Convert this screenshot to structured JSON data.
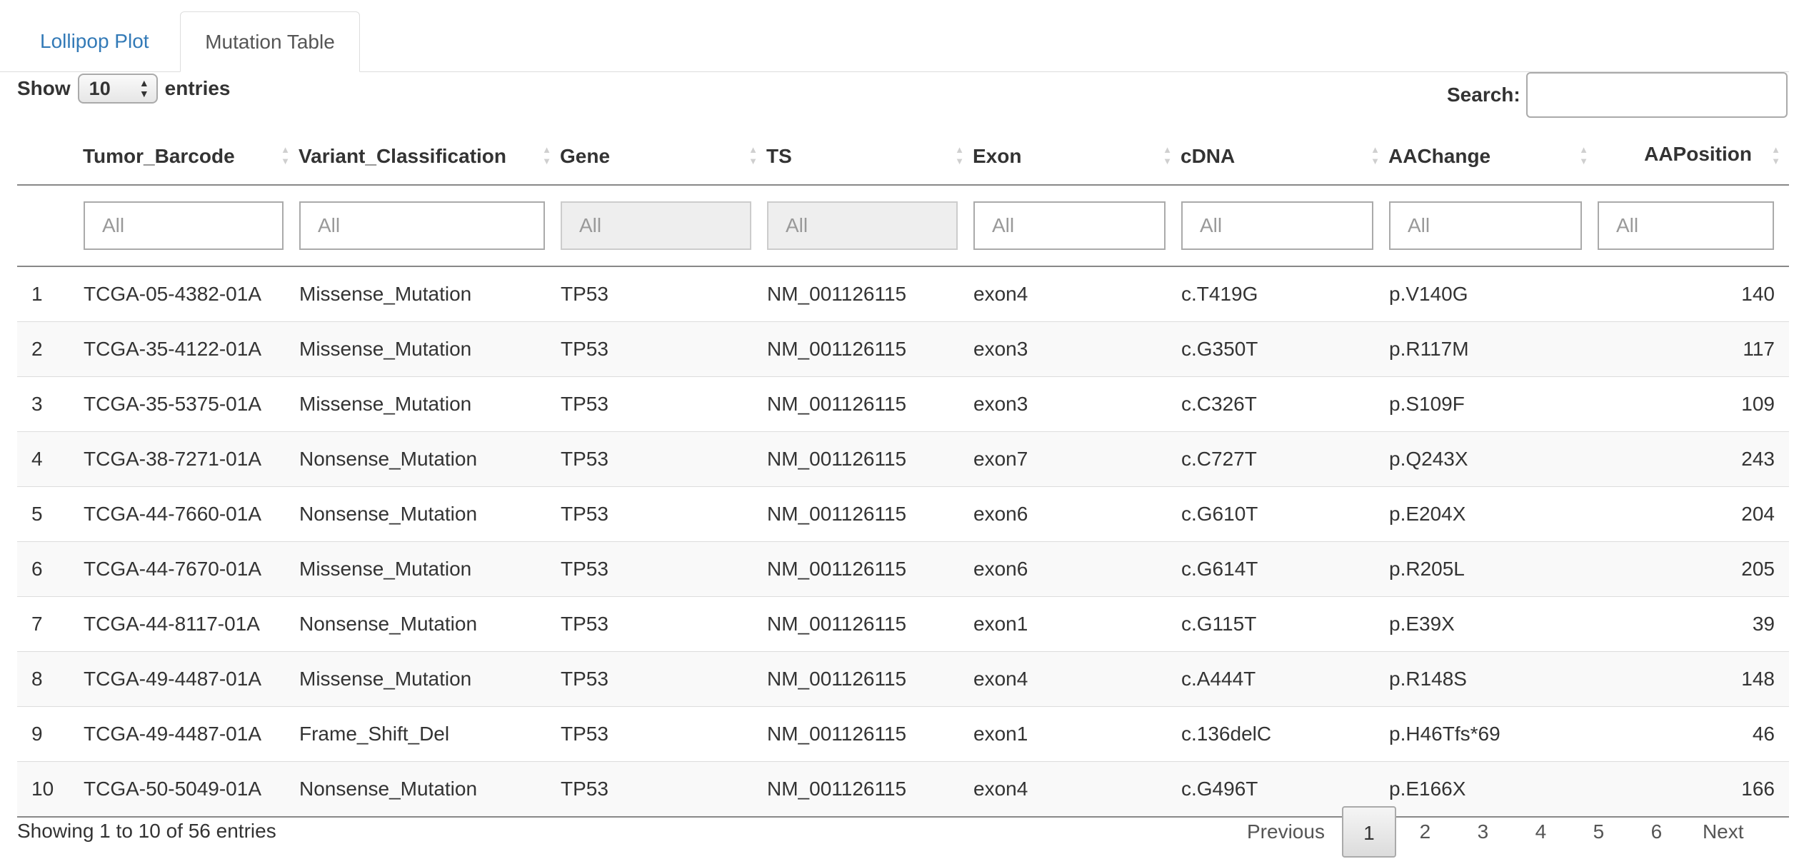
{
  "tabs": [
    {
      "label": "Lollipop Plot",
      "active": false
    },
    {
      "label": "Mutation Table",
      "active": true
    }
  ],
  "length": {
    "show": "Show",
    "value": "10",
    "entries": "entries"
  },
  "search": {
    "label": "Search:",
    "value": ""
  },
  "table": {
    "columns": [
      "",
      "Tumor_Barcode",
      "Variant_Classification",
      "Gene",
      "TS",
      "Exon",
      "cDNA",
      "AAChange",
      "AAPosition"
    ],
    "filter_placeholder": "All",
    "rows": [
      [
        "1",
        "TCGA-05-4382-01A",
        "Missense_Mutation",
        "TP53",
        "NM_001126115",
        "exon4",
        "c.T419G",
        "p.V140G",
        "140"
      ],
      [
        "2",
        "TCGA-35-4122-01A",
        "Missense_Mutation",
        "TP53",
        "NM_001126115",
        "exon3",
        "c.G350T",
        "p.R117M",
        "117"
      ],
      [
        "3",
        "TCGA-35-5375-01A",
        "Missense_Mutation",
        "TP53",
        "NM_001126115",
        "exon3",
        "c.C326T",
        "p.S109F",
        "109"
      ],
      [
        "4",
        "TCGA-38-7271-01A",
        "Nonsense_Mutation",
        "TP53",
        "NM_001126115",
        "exon7",
        "c.C727T",
        "p.Q243X",
        "243"
      ],
      [
        "5",
        "TCGA-44-7660-01A",
        "Nonsense_Mutation",
        "TP53",
        "NM_001126115",
        "exon6",
        "c.G610T",
        "p.E204X",
        "204"
      ],
      [
        "6",
        "TCGA-44-7670-01A",
        "Missense_Mutation",
        "TP53",
        "NM_001126115",
        "exon6",
        "c.G614T",
        "p.R205L",
        "205"
      ],
      [
        "7",
        "TCGA-44-8117-01A",
        "Nonsense_Mutation",
        "TP53",
        "NM_001126115",
        "exon1",
        "c.G115T",
        "p.E39X",
        "39"
      ],
      [
        "8",
        "TCGA-49-4487-01A",
        "Missense_Mutation",
        "TP53",
        "NM_001126115",
        "exon4",
        "c.A444T",
        "p.R148S",
        "148"
      ],
      [
        "9",
        "TCGA-49-4487-01A",
        "Frame_Shift_Del",
        "TP53",
        "NM_001126115",
        "exon1",
        "c.136delC",
        "p.H46Tfs*69",
        "46"
      ],
      [
        "10",
        "TCGA-50-5049-01A",
        "Nonsense_Mutation",
        "TP53",
        "NM_001126115",
        "exon4",
        "c.G496T",
        "p.E166X",
        "166"
      ]
    ]
  },
  "info": "Showing 1 to 10 of 56 entries",
  "pagination": {
    "previous": "Previous",
    "pages": [
      "1",
      "2",
      "3",
      "4",
      "5",
      "6"
    ],
    "current": "1",
    "next": "Next"
  }
}
